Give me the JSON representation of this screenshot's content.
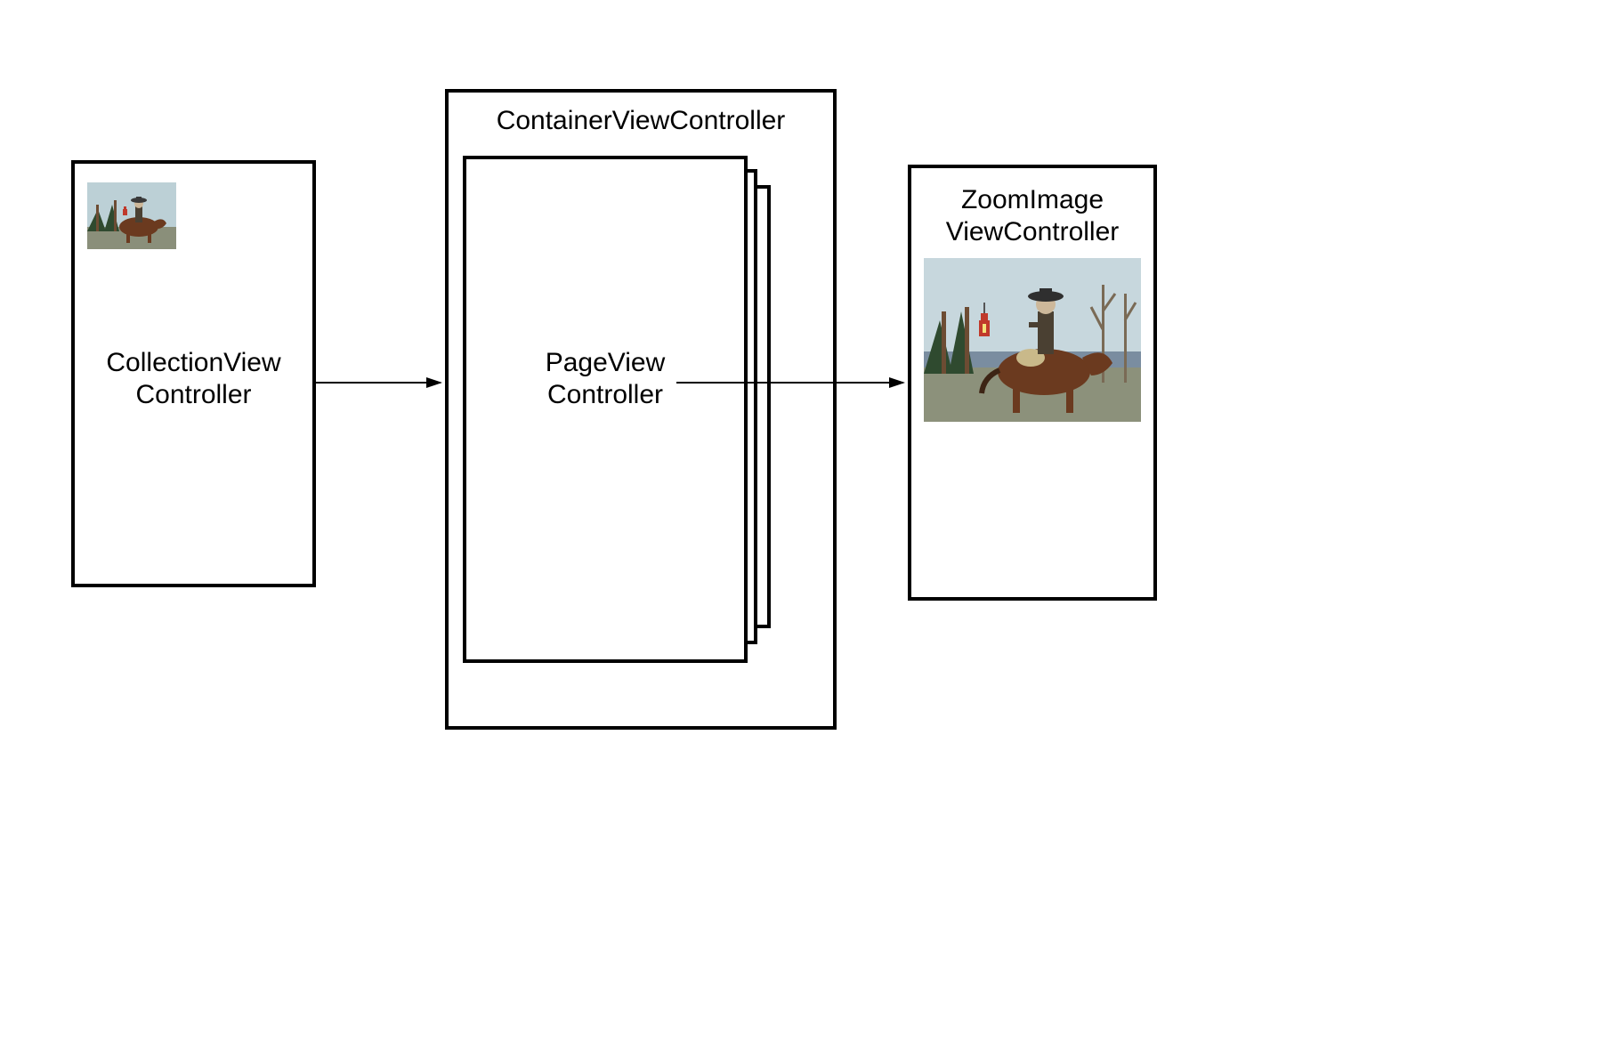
{
  "boxes": {
    "collection": {
      "label_line1": "CollectionView",
      "label_line2": "Controller"
    },
    "container": {
      "title": "ContainerViewController",
      "page_label_line1": "PageView",
      "page_label_line2": "Controller"
    },
    "zoom": {
      "label_line1": "ZoomImage",
      "label_line2": "ViewController"
    }
  },
  "thumbnails": {
    "small_alt": "cowboy-on-horse-thumbnail",
    "large_alt": "cowboy-on-horse-large"
  }
}
